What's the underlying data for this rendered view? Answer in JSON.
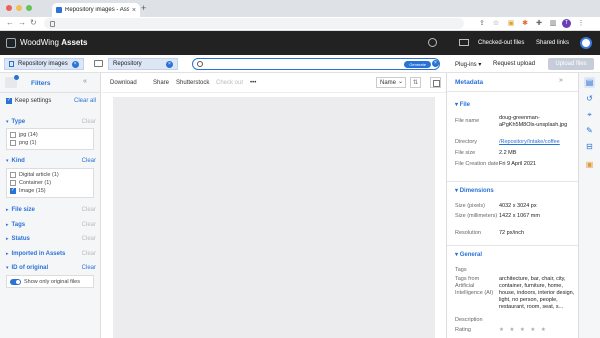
{
  "browser": {
    "tab_title": "Repository images - Assets",
    "tab_close": "×",
    "new_tab": "+",
    "back": "←",
    "forward": "→",
    "reload": "↻",
    "profile_initial": "T"
  },
  "header": {
    "logo_brand": "WoodWing",
    "logo_product": "Assets",
    "checked_out": "Checked-out files",
    "shared_links": "Shared links"
  },
  "toolbar": {
    "collection_chip": "Repository images",
    "location_chip": "Repository",
    "search_placeholder": "",
    "generate": "Generate",
    "plugins": "Plug-ins",
    "plugins_arrow": "▾",
    "request_upload": "Request upload",
    "upload": "Upload files"
  },
  "filters": {
    "title": "Filters",
    "collapse": "«",
    "keep_settings": "Keep settings",
    "clear_all": "Clear all",
    "type": {
      "title": "Type",
      "clear": "Clear",
      "options": [
        {
          "label": "jpg (14)",
          "checked": false
        },
        {
          "label": "png (1)",
          "checked": false
        }
      ]
    },
    "kind": {
      "title": "Kind",
      "clear": "Clear",
      "options": [
        {
          "label": "Digital article (1)",
          "checked": false
        },
        {
          "label": "Container (1)",
          "checked": false
        },
        {
          "label": "Image (15)",
          "checked": true
        }
      ]
    },
    "file_size": {
      "title": "File size",
      "clear": "Clear"
    },
    "tags": {
      "title": "Tags",
      "clear": "Clear"
    },
    "status": {
      "title": "Status",
      "clear": "Clear"
    },
    "imported": {
      "title": "Imported in Assets",
      "clear": "Clear"
    },
    "id_original": {
      "title": "ID of original",
      "clear": "Clear",
      "toggle_label": "Show only original files"
    }
  },
  "center": {
    "download": "Download",
    "share": "Share",
    "shutterstock": "Shutterstock",
    "check_out": "Check out",
    "more": "•••",
    "sort": "Name",
    "sort_arrow": "⌄",
    "sort_dir": "⇅"
  },
  "metadata": {
    "title": "Metadata",
    "collapse": "»",
    "file_section": "File",
    "file_name_key": "File name",
    "file_name_val": "doug-greenman-aPgKh5M8Ols-unsplash.jpg",
    "directory_key": "Directory",
    "directory_val": "/Repository/Intake/coffee",
    "file_size_key": "File size",
    "file_size_val": "2.2 MB",
    "creation_key": "File Creation date",
    "creation_val": "Fri 9 April 2021",
    "dimensions_section": "Dimensions",
    "size_px_key": "Size (pixels)",
    "size_px_val": "4032 x 3024 px",
    "size_mm_key": "Size (millimeters)",
    "size_mm_val": "1422 x 1067 mm",
    "resolution_key": "Resolution",
    "resolution_val": "72 px/inch",
    "general_section": "General",
    "tags_key": "Tags",
    "ai_tags_key": "Tags from Artificial Intelligence (AI)",
    "ai_tags_val": "architecture, bar, chair, city, container, furniture, home, house, indoors, interior design, light, no person, people, restaurant, room, seat, s...",
    "description_key": "Description",
    "rating_key": "Rating",
    "rating_stars": "★ ★ ★ ★ ★"
  },
  "colors": {
    "accent": "#2a72d6",
    "header_bg": "#222222"
  }
}
